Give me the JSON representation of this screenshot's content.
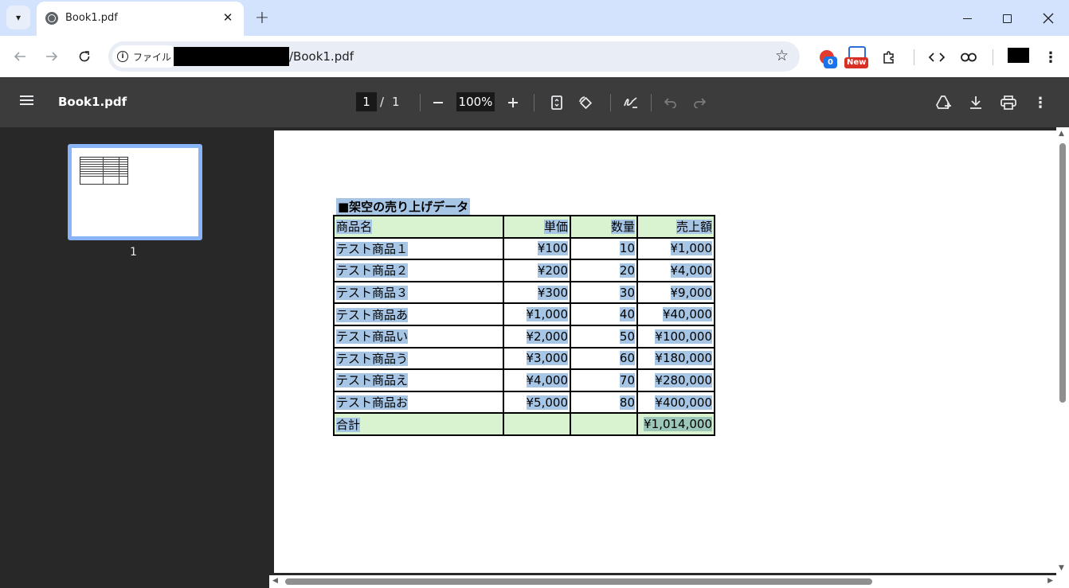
{
  "browser": {
    "tab_title": "Book1.pdf",
    "tab_close": "✕",
    "new_tab": "+",
    "address": {
      "scheme_label": "ファイル",
      "url_suffix": "/Book1.pdf"
    },
    "extensions": {
      "badge_count": "0",
      "new_label": "New"
    }
  },
  "pdf_viewer": {
    "title": "Book1.pdf",
    "current_page": "1",
    "page_separator": "/",
    "total_pages": "1",
    "zoom": "100%"
  },
  "sidebar": {
    "thumbnails": [
      {
        "page_label": "1"
      }
    ]
  },
  "document": {
    "heading": "■架空の売り上げデータ",
    "columns": [
      "商品名",
      "単価",
      "数量",
      "売上額"
    ],
    "rows": [
      [
        "テスト商品１",
        "¥100",
        "10",
        "¥1,000"
      ],
      [
        "テスト商品２",
        "¥200",
        "20",
        "¥4,000"
      ],
      [
        "テスト商品３",
        "¥300",
        "30",
        "¥9,000"
      ],
      [
        "テスト商品あ",
        "¥1,000",
        "40",
        "¥40,000"
      ],
      [
        "テスト商品い",
        "¥2,000",
        "50",
        "¥100,000"
      ],
      [
        "テスト商品う",
        "¥3,000",
        "60",
        "¥180,000"
      ],
      [
        "テスト商品え",
        "¥4,000",
        "70",
        "¥280,000"
      ],
      [
        "テスト商品お",
        "¥5,000",
        "80",
        "¥400,000"
      ]
    ],
    "total_label": "合計",
    "total_value": "¥1,014,000"
  },
  "colors": {
    "selection_highlight": "#a7c6e5",
    "header_fill": "#d9f2d0",
    "viewer_toolbar": "#3c3c3c",
    "sidebar_bg": "#282828",
    "thumbnail_border": "#8ab4f8"
  }
}
